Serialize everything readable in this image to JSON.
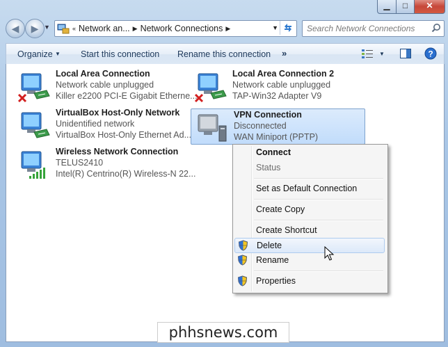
{
  "nav": {
    "breadcrumbs": [
      "Network an...",
      "Network Connections"
    ],
    "search_placeholder": "Search Network Connections"
  },
  "toolbar": {
    "organize": "Organize",
    "start": "Start this connection",
    "rename": "Rename this connection",
    "more": "»"
  },
  "connections": [
    {
      "name": "Local Area Connection",
      "status": "Network cable unplugged",
      "device": "Killer e2200 PCI-E Gigabit Etherne...",
      "icon": "wired-unplugged"
    },
    {
      "name": "Local Area Connection 2",
      "status": "Network cable unplugged",
      "device": "TAP-Win32 Adapter V9",
      "icon": "wired-unplugged"
    },
    {
      "name": "VirtualBox Host-Only Network",
      "status": "Unidentified network",
      "device": "VirtualBox Host-Only Ethernet Ad...",
      "icon": "wired"
    },
    {
      "name": "VPN Connection",
      "status": "Disconnected",
      "device": "WAN Miniport (PPTP)",
      "icon": "vpn",
      "selected": true
    },
    {
      "name": "Wireless Network Connection",
      "status": "TELUS2410",
      "device": "Intel(R) Centrino(R) Wireless-N 22...",
      "icon": "wireless"
    }
  ],
  "context_menu": {
    "items": [
      {
        "label": "Connect",
        "bold": true
      },
      {
        "label": "Status",
        "disabled": true
      },
      {
        "label": "Set as Default Connection"
      },
      {
        "label": "Create Copy"
      },
      {
        "label": "Create Shortcut"
      },
      {
        "label": "Delete",
        "shield": true,
        "hover": true
      },
      {
        "label": "Rename",
        "shield": true
      },
      {
        "label": "Properties",
        "shield": true
      }
    ]
  },
  "watermark": "phhsnews.com"
}
